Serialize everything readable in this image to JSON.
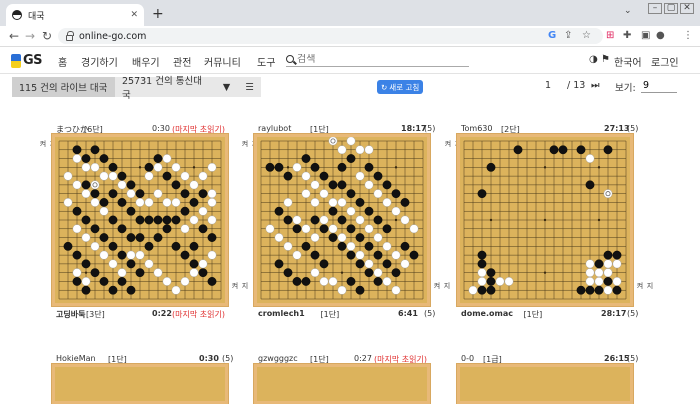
{
  "browser": {
    "tab_title": "대국",
    "url": "online-go.com"
  },
  "nav": {
    "logo": "GS",
    "menu": [
      "홈",
      "경기하기",
      "배우기",
      "관전",
      "커뮤니티",
      "도구"
    ],
    "search_placeholder": "검색",
    "language": "한국어",
    "login": "로그인"
  },
  "toolbar": {
    "live_label": "115 건의 라이브 대국",
    "corr_label": "25731 건의 통신대국",
    "refresh_label": "새로 고침",
    "page_current": "1",
    "page_total": "/ 13",
    "view_label": "보기:",
    "view_value": "9"
  },
  "colors": {
    "board": "#dcb35c",
    "board_border": "#e8b978",
    "accent": "#3b82e6",
    "warn": "#e03030"
  },
  "games": [
    {
      "top_name": "まつひか",
      "top_rank": "[6단]",
      "top_time": "0:30",
      "top_note": "(마지막 초읽기)",
      "bottom_name": "고딩바둑",
      "bottom_rank": "[3단]",
      "bottom_time": "0:22",
      "bottom_note": "(마지막 초읽기)",
      "side_label": "지켜",
      "black": [
        [
          2,
          1
        ],
        [
          3,
          2
        ],
        [
          4,
          1
        ],
        [
          5,
          2
        ],
        [
          6,
          3
        ],
        [
          7,
          4
        ],
        [
          8,
          5
        ],
        [
          9,
          6
        ],
        [
          10,
          3
        ],
        [
          11,
          2
        ],
        [
          12,
          4
        ],
        [
          13,
          5
        ],
        [
          14,
          6
        ],
        [
          3,
          5
        ],
        [
          4,
          6
        ],
        [
          5,
          7
        ],
        [
          2,
          8
        ],
        [
          3,
          9
        ],
        [
          4,
          10
        ],
        [
          5,
          11
        ],
        [
          6,
          12
        ],
        [
          7,
          13
        ],
        [
          8,
          14
        ],
        [
          9,
          15
        ],
        [
          10,
          12
        ],
        [
          11,
          11
        ],
        [
          12,
          10
        ],
        [
          13,
          9
        ],
        [
          14,
          8
        ],
        [
          15,
          7
        ],
        [
          16,
          6
        ],
        [
          1,
          12
        ],
        [
          2,
          13
        ],
        [
          3,
          14
        ],
        [
          4,
          15
        ],
        [
          5,
          16
        ],
        [
          6,
          17
        ],
        [
          7,
          16
        ],
        [
          8,
          17
        ],
        [
          9,
          9
        ],
        [
          10,
          9
        ],
        [
          11,
          9
        ],
        [
          12,
          9
        ],
        [
          13,
          12
        ],
        [
          14,
          13
        ],
        [
          15,
          14
        ],
        [
          16,
          15
        ],
        [
          17,
          16
        ],
        [
          6,
          6
        ],
        [
          7,
          7
        ],
        [
          8,
          8
        ],
        [
          6,
          9
        ],
        [
          7,
          10
        ],
        [
          8,
          11
        ],
        [
          9,
          11
        ],
        [
          16,
          10
        ],
        [
          17,
          11
        ],
        [
          15,
          12
        ],
        [
          2,
          16
        ],
        [
          3,
          17
        ]
      ],
      "white": [
        [
          2,
          2
        ],
        [
          3,
          3
        ],
        [
          4,
          3
        ],
        [
          5,
          4
        ],
        [
          6,
          4
        ],
        [
          7,
          5
        ],
        [
          8,
          6
        ],
        [
          9,
          7
        ],
        [
          10,
          4
        ],
        [
          11,
          3
        ],
        [
          12,
          2
        ],
        [
          13,
          3
        ],
        [
          14,
          4
        ],
        [
          15,
          5
        ],
        [
          16,
          4
        ],
        [
          17,
          3
        ],
        [
          2,
          5
        ],
        [
          3,
          6
        ],
        [
          4,
          7
        ],
        [
          5,
          8
        ],
        [
          2,
          10
        ],
        [
          3,
          11
        ],
        [
          4,
          12
        ],
        [
          5,
          13
        ],
        [
          6,
          14
        ],
        [
          7,
          15
        ],
        [
          8,
          13
        ],
        [
          9,
          13
        ],
        [
          10,
          14
        ],
        [
          11,
          15
        ],
        [
          12,
          16
        ],
        [
          13,
          17
        ],
        [
          14,
          16
        ],
        [
          15,
          15
        ],
        [
          16,
          14
        ],
        [
          17,
          13
        ],
        [
          16,
          8
        ],
        [
          17,
          9
        ],
        [
          15,
          9
        ],
        [
          14,
          10
        ],
        [
          11,
          6
        ],
        [
          12,
          7
        ],
        [
          13,
          7
        ],
        [
          10,
          7
        ],
        [
          1,
          4
        ],
        [
          1,
          7
        ],
        [
          2,
          15
        ],
        [
          3,
          16
        ],
        [
          17,
          6
        ],
        [
          17,
          7
        ]
      ],
      "marked": [
        [
          4,
          5
        ]
      ]
    },
    {
      "top_name": "raylubot",
      "top_rank": "[1단]",
      "top_time": "18:17",
      "top_note": "(5)",
      "bottom_name": "cromlech1",
      "bottom_rank": "[1단]",
      "bottom_time": "6:41",
      "bottom_note": "(5)",
      "side_label": "지켜",
      "black": [
        [
          1,
          3
        ],
        [
          2,
          3
        ],
        [
          3,
          4
        ],
        [
          5,
          2
        ],
        [
          6,
          3
        ],
        [
          7,
          4
        ],
        [
          8,
          5
        ],
        [
          9,
          5
        ],
        [
          10,
          6
        ],
        [
          11,
          7
        ],
        [
          12,
          8
        ],
        [
          13,
          9
        ],
        [
          14,
          10
        ],
        [
          8,
          8
        ],
        [
          9,
          9
        ],
        [
          10,
          10
        ],
        [
          11,
          11
        ],
        [
          12,
          12
        ],
        [
          13,
          13
        ],
        [
          14,
          14
        ],
        [
          15,
          15
        ],
        [
          6,
          9
        ],
        [
          7,
          10
        ],
        [
          8,
          11
        ],
        [
          9,
          12
        ],
        [
          10,
          13
        ],
        [
          11,
          14
        ],
        [
          12,
          15
        ],
        [
          13,
          16
        ],
        [
          5,
          12
        ],
        [
          6,
          13
        ],
        [
          7,
          14
        ],
        [
          2,
          14
        ],
        [
          3,
          15
        ],
        [
          4,
          16
        ],
        [
          5,
          16
        ],
        [
          14,
          5
        ],
        [
          15,
          6
        ],
        [
          16,
          7
        ],
        [
          12,
          3
        ],
        [
          13,
          4
        ],
        [
          10,
          2
        ],
        [
          16,
          12
        ],
        [
          17,
          13
        ],
        [
          2,
          8
        ],
        [
          3,
          9
        ],
        [
          4,
          10
        ],
        [
          9,
          3
        ],
        [
          10,
          16
        ],
        [
          11,
          17
        ]
      ],
      "white": [
        [
          4,
          3
        ],
        [
          5,
          4
        ],
        [
          6,
          5
        ],
        [
          7,
          6
        ],
        [
          8,
          7
        ],
        [
          9,
          7
        ],
        [
          10,
          8
        ],
        [
          11,
          9
        ],
        [
          12,
          10
        ],
        [
          13,
          11
        ],
        [
          14,
          12
        ],
        [
          15,
          13
        ],
        [
          16,
          14
        ],
        [
          7,
          9
        ],
        [
          8,
          10
        ],
        [
          9,
          11
        ],
        [
          10,
          12
        ],
        [
          11,
          13
        ],
        [
          12,
          14
        ],
        [
          13,
          15
        ],
        [
          14,
          16
        ],
        [
          15,
          17
        ],
        [
          4,
          9
        ],
        [
          5,
          10
        ],
        [
          6,
          11
        ],
        [
          6,
          15
        ],
        [
          7,
          16
        ],
        [
          8,
          16
        ],
        [
          9,
          17
        ],
        [
          3,
          12
        ],
        [
          4,
          13
        ],
        [
          14,
          7
        ],
        [
          15,
          8
        ],
        [
          16,
          9
        ],
        [
          17,
          10
        ],
        [
          11,
          4
        ],
        [
          12,
          5
        ],
        [
          13,
          6
        ],
        [
          9,
          1
        ],
        [
          10,
          0
        ],
        [
          11,
          1
        ],
        [
          12,
          1
        ],
        [
          6,
          7
        ],
        [
          5,
          6
        ],
        [
          3,
          7
        ],
        [
          1,
          10
        ],
        [
          2,
          11
        ]
      ],
      "marked": [
        [
          8,
          0
        ]
      ]
    },
    {
      "top_name": "Tom630",
      "top_rank": "[2단]",
      "top_time": "27:13",
      "top_note": "(5)",
      "bottom_name": "dome.omac",
      "bottom_rank": "[1단]",
      "bottom_time": "28:17",
      "bottom_note": "(5)",
      "side_label": "지켜",
      "black": [
        [
          3,
          3
        ],
        [
          2,
          6
        ],
        [
          6,
          1
        ],
        [
          10,
          1
        ],
        [
          11,
          1
        ],
        [
          13,
          1
        ],
        [
          16,
          1
        ],
        [
          14,
          5
        ],
        [
          2,
          13
        ],
        [
          2,
          14
        ],
        [
          3,
          15
        ],
        [
          3,
          16
        ],
        [
          3,
          17
        ],
        [
          2,
          17
        ],
        [
          15,
          14
        ],
        [
          16,
          13
        ],
        [
          17,
          13
        ],
        [
          16,
          16
        ],
        [
          17,
          17
        ],
        [
          15,
          17
        ],
        [
          14,
          17
        ],
        [
          13,
          17
        ]
      ],
      "white": [
        [
          14,
          2
        ],
        [
          2,
          15
        ],
        [
          2,
          16
        ],
        [
          4,
          16
        ],
        [
          1,
          17
        ],
        [
          14,
          14
        ],
        [
          14,
          15
        ],
        [
          14,
          16
        ],
        [
          15,
          15
        ],
        [
          15,
          16
        ],
        [
          16,
          14
        ],
        [
          16,
          15
        ],
        [
          17,
          14
        ],
        [
          17,
          16
        ],
        [
          16,
          17
        ],
        [
          5,
          16
        ]
      ],
      "marked": [
        [
          16,
          6
        ]
      ]
    }
  ],
  "games_row2": [
    {
      "top_name": "HokieMan",
      "top_rank": "[1단]",
      "top_time": "0:30",
      "top_note": "(5)"
    },
    {
      "top_name": "gzwgggzc",
      "top_rank": "[1단]",
      "top_time": "0:27",
      "top_note": "(마지막 초읽기)"
    },
    {
      "top_name": "0-0",
      "top_rank": "[1급]",
      "top_time": "26:15",
      "top_note": "(5)"
    }
  ]
}
